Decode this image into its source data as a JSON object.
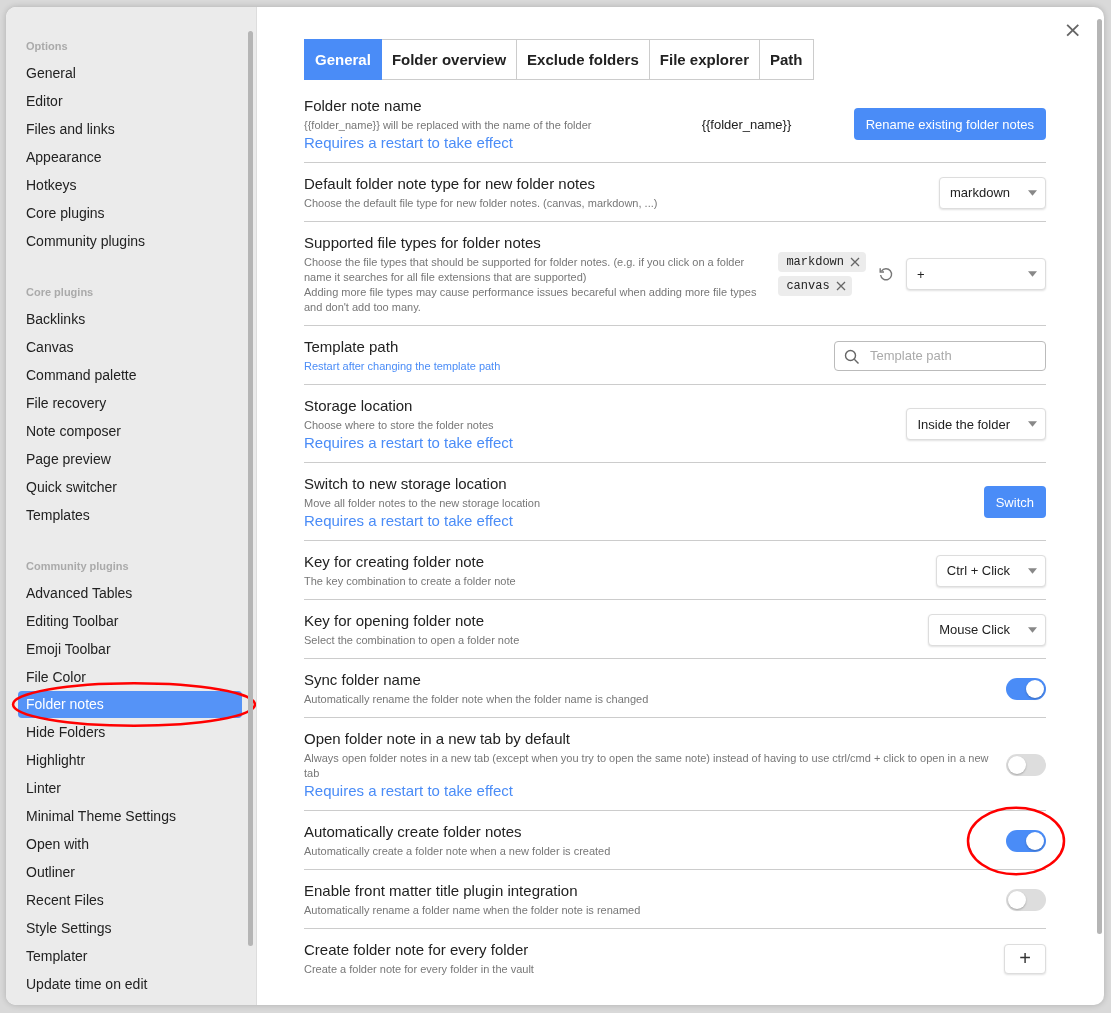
{
  "close": "×",
  "sidebar": {
    "sections": [
      {
        "heading": "Options",
        "items": [
          {
            "label": "General",
            "selected": false
          },
          {
            "label": "Editor",
            "selected": false
          },
          {
            "label": "Files and links",
            "selected": false
          },
          {
            "label": "Appearance",
            "selected": false
          },
          {
            "label": "Hotkeys",
            "selected": false
          },
          {
            "label": "Core plugins",
            "selected": false
          },
          {
            "label": "Community plugins",
            "selected": false
          }
        ]
      },
      {
        "heading": "Core plugins",
        "items": [
          {
            "label": "Backlinks",
            "selected": false
          },
          {
            "label": "Canvas",
            "selected": false
          },
          {
            "label": "Command palette",
            "selected": false
          },
          {
            "label": "File recovery",
            "selected": false
          },
          {
            "label": "Note composer",
            "selected": false
          },
          {
            "label": "Page preview",
            "selected": false
          },
          {
            "label": "Quick switcher",
            "selected": false
          },
          {
            "label": "Templates",
            "selected": false
          }
        ]
      },
      {
        "heading": "Community plugins",
        "items": [
          {
            "label": "Advanced Tables",
            "selected": false
          },
          {
            "label": "Editing Toolbar",
            "selected": false
          },
          {
            "label": "Emoji Toolbar",
            "selected": false
          },
          {
            "label": "File Color",
            "selected": false
          },
          {
            "label": "Folder notes",
            "selected": true,
            "circled": true
          },
          {
            "label": "Hide Folders",
            "selected": false
          },
          {
            "label": "Highlightr",
            "selected": false
          },
          {
            "label": "Linter",
            "selected": false
          },
          {
            "label": "Minimal Theme Settings",
            "selected": false
          },
          {
            "label": "Open with",
            "selected": false
          },
          {
            "label": "Outliner",
            "selected": false
          },
          {
            "label": "Recent Files",
            "selected": false
          },
          {
            "label": "Style Settings",
            "selected": false
          },
          {
            "label": "Templater",
            "selected": false
          },
          {
            "label": "Update time on edit",
            "selected": false
          }
        ]
      }
    ]
  },
  "tabs": [
    {
      "label": "General",
      "selected": true
    },
    {
      "label": "Folder overview",
      "selected": false
    },
    {
      "label": "Exclude folders",
      "selected": false
    },
    {
      "label": "File explorer",
      "selected": false
    },
    {
      "label": "Path",
      "selected": false
    }
  ],
  "settings": [
    {
      "kind": "text",
      "name": "Folder note name",
      "desc": [
        "{{folder_name}} will be replaced with the name of the folder"
      ],
      "restart_note": "Requires a restart to take effect",
      "value": "{{folder_name}}",
      "button": "Rename existing folder notes"
    },
    {
      "kind": "dropdown",
      "name": "Default folder note type for new folder notes",
      "desc": [
        "Choose the default file type for new folder notes. (canvas, markdown, ...)"
      ],
      "value": "markdown"
    },
    {
      "kind": "tags",
      "name": "Supported file types for folder notes",
      "desc": [
        "Choose the file types that should be supported for folder notes. (e.g. if you click on a folder name it searches for all file extensions that are supported)",
        "Adding more file types may cause performance issues becareful when adding more file types and don't add too many."
      ],
      "tags": [
        "markdown",
        "canvas"
      ],
      "value": "+"
    },
    {
      "kind": "search",
      "name": "Template path",
      "desc": [
        "Restart after changing the template path"
      ],
      "desc_link": true,
      "placeholder": "Template path"
    },
    {
      "kind": "dropdown",
      "name": "Storage location",
      "desc": [
        "Choose where to store the folder notes"
      ],
      "restart_note": "Requires a restart to take effect",
      "value": "Inside the folder"
    },
    {
      "kind": "button",
      "name": "Switch to new storage location",
      "desc": [
        "Move all folder notes to the new storage location"
      ],
      "restart_note": "Requires a restart to take effect",
      "button": "Switch"
    },
    {
      "kind": "dropdown",
      "name": "Key for creating folder note",
      "desc": [
        "The key combination to create a folder note"
      ],
      "value": "Ctrl + Click"
    },
    {
      "kind": "dropdown",
      "name": "Key for opening folder note",
      "desc": [
        "Select the combination to open a folder note"
      ],
      "value": "Mouse Click"
    },
    {
      "kind": "toggle",
      "name": "Sync folder name",
      "desc": [
        "Automatically rename the folder note when the folder name is changed"
      ],
      "on": true
    },
    {
      "kind": "toggle",
      "name": "Open folder note in a new tab by default",
      "desc": [
        "Always open folder notes in a new tab (except when you try to open the same note) instead of having to use ctrl/cmd + click to open in a new tab"
      ],
      "restart_note": "Requires a restart to take effect",
      "on": false
    },
    {
      "kind": "toggle",
      "name": "Automatically create folder notes",
      "desc": [
        "Automatically create a folder note when a new folder is created"
      ],
      "on": true,
      "circled": true
    },
    {
      "kind": "toggle",
      "name": "Enable front matter title plugin integration",
      "desc": [
        "Automatically rename a folder name when the folder note is renamed"
      ],
      "on": false
    },
    {
      "kind": "add",
      "name": "Create folder note for every folder",
      "desc": [
        "Create a folder note for every folder in the vault"
      ],
      "button": "+"
    }
  ]
}
